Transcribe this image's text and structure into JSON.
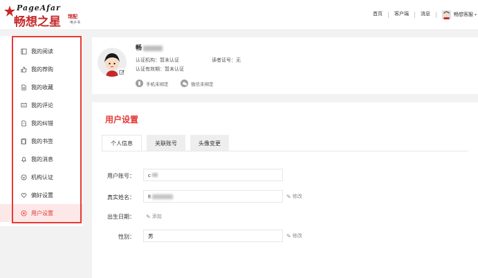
{
  "header": {
    "logo_en": "PageAfar",
    "logo_cn": "畅想之星",
    "logo_side1": "馆配",
    "logo_side2": "电子书",
    "nav": [
      "首页",
      "客户端",
      "消息"
    ],
    "user_name": "畅想客服"
  },
  "sidebar": {
    "items": [
      {
        "label": "我的阅读",
        "icon": "book-icon"
      },
      {
        "label": "我的荐购",
        "icon": "thumb-up-icon"
      },
      {
        "label": "我的收藏",
        "icon": "bookmark-doc-icon"
      },
      {
        "label": "我的评论",
        "icon": "comment-icon"
      },
      {
        "label": "我的纠错",
        "icon": "error-doc-icon"
      },
      {
        "label": "我的书签",
        "icon": "bookmark-icon"
      },
      {
        "label": "我的消息",
        "icon": "bell-icon"
      },
      {
        "label": "机构认证",
        "icon": "institution-icon"
      },
      {
        "label": "偏好设置",
        "icon": "heart-icon"
      },
      {
        "label": "用户设置",
        "icon": "user-settings-icon"
      }
    ],
    "active_index": 9
  },
  "profile": {
    "name_prefix": "畅",
    "org": "认证机构：暂未认证",
    "reader_id": "读者证号：无",
    "valid": "认证有效期：暂未认证",
    "phone_bind": "手机未绑定",
    "wechat_bind": "微信未绑定"
  },
  "settings": {
    "title": "用户设置",
    "tabs": [
      "个人信息",
      "关联账号",
      "头像变更"
    ],
    "account_label": "用户账号：",
    "account_value": "c",
    "realname_label": "真实姓名：",
    "realname_value": "fl",
    "edit_text": "修改",
    "birth_label": "出生日期：",
    "add_text": "添加",
    "gender_label": "性别：",
    "gender_value": "男"
  },
  "colors": {
    "accent": "#e53935",
    "active_bg": "#fde8e8"
  }
}
